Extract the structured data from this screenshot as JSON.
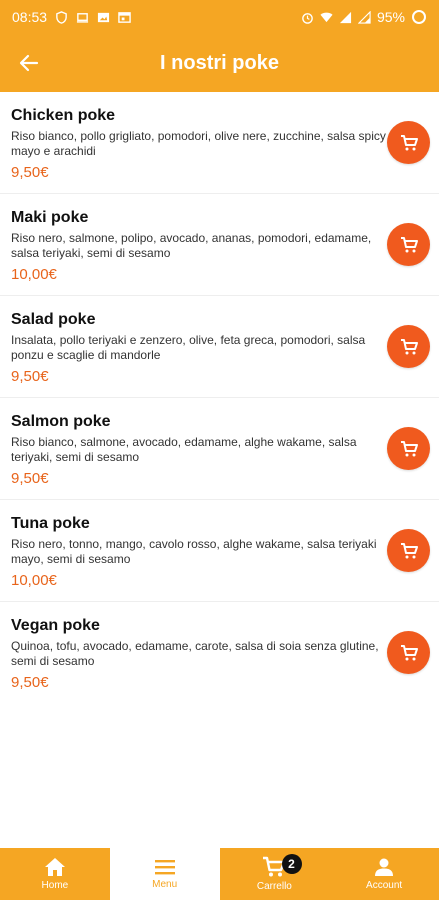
{
  "status_bar": {
    "time": "08:53",
    "battery": "95%"
  },
  "header": {
    "title": "I nostri poke",
    "back_icon": "arrow-left-icon"
  },
  "items": [
    {
      "name": "Chicken poke",
      "description": "Riso bianco, pollo grigliato, pomodori, olive nere, zucchine, salsa spicy mayo e arachidi",
      "price": "9,50€"
    },
    {
      "name": "Maki poke",
      "description": "Riso nero, salmone, polipo, avocado, ananas, pomodori, edamame, salsa teriyaki, semi di sesamo",
      "price": "10,00€"
    },
    {
      "name": "Salad poke",
      "description": "Insalata, pollo teriyaki e zenzero, olive, feta greca, pomodori, salsa ponzu e scaglie di mandorle",
      "price": "9,50€"
    },
    {
      "name": "Salmon poke",
      "description": "Riso bianco, salmone, avocado, edamame, alghe wakame, salsa teriyaki, semi di sesamo",
      "price": "9,50€"
    },
    {
      "name": "Tuna poke",
      "description": "Riso nero, tonno, mango, cavolo rosso, alghe wakame, salsa teriyaki mayo, semi di sesamo",
      "price": "10,00€"
    },
    {
      "name": "Vegan poke",
      "description": "Quinoa, tofu, avocado, edamame, carote, salsa di soia senza glutine, semi di sesamo",
      "price": "9,50€"
    }
  ],
  "nav": {
    "home": "Home",
    "menu": "Menu",
    "cart": "Carrello",
    "cart_badge": "2",
    "account": "Account"
  },
  "colors": {
    "primary": "#f5a623",
    "accent": "#f05a1e",
    "price": "#e8641b"
  }
}
